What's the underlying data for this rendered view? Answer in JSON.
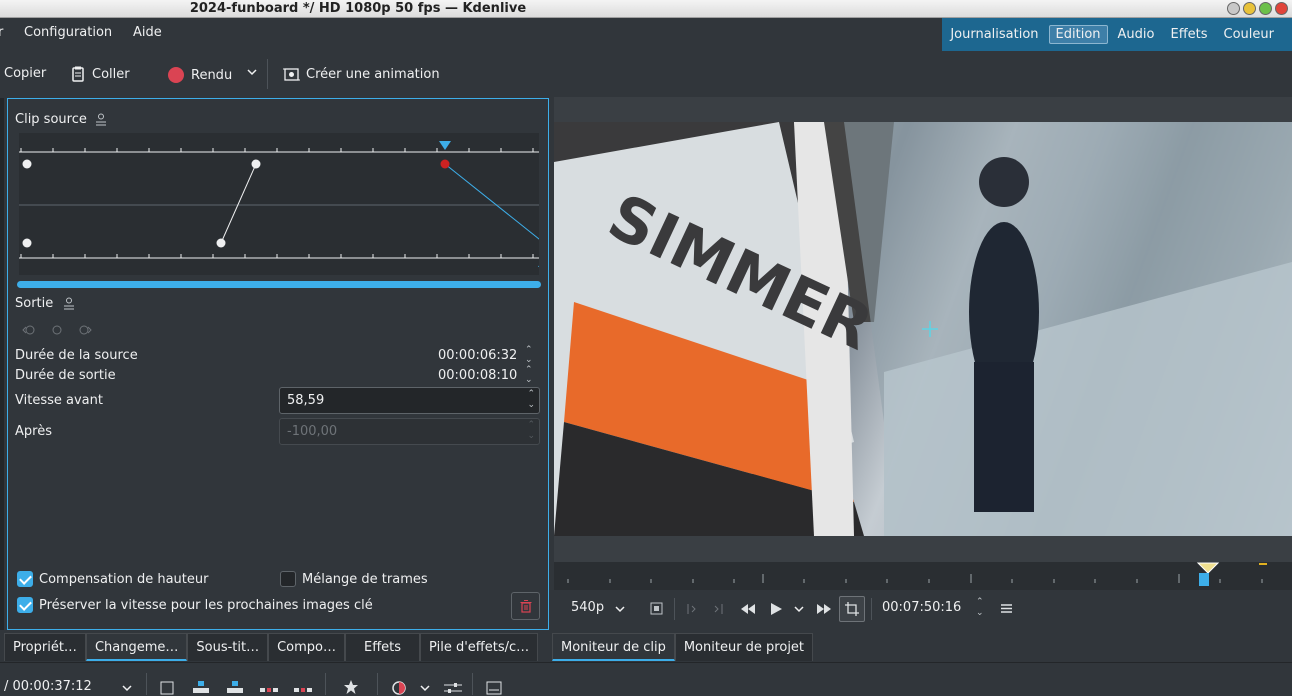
{
  "window": {
    "title": "2024-funboard */ HD 1080p 50 fps — Kdenlive"
  },
  "menu": {
    "items": [
      "Configuration",
      "Aide"
    ],
    "left_fragment": "r"
  },
  "layouts": {
    "items": [
      "Journalisation",
      "Edition",
      "Audio",
      "Effets",
      "Couleur"
    ],
    "active": "Edition"
  },
  "toolbar": {
    "copy": "Copier",
    "paste": "Coller",
    "render": "Rendu",
    "animation": "Créer une animation"
  },
  "panel": {
    "source_title": "Clip source",
    "output_title": "Sortie",
    "source_duration_label": "Durée de la source",
    "source_duration": "00:00:06:32",
    "output_duration_label": "Durée de sortie",
    "output_duration": "00:00:08:10",
    "speed_before_label": "Vitesse avant",
    "speed_before": "58,59",
    "after_label": "Après",
    "after_value": "-100,00",
    "pitch_comp": "Compensation de hauteur",
    "frame_blend": "Mélange de trames",
    "preserve_speed": "Préserver la vitesse pour les prochaines images clé",
    "pitch_comp_checked": true,
    "frame_blend_checked": false,
    "preserve_checked": true
  },
  "monitor": {
    "zoom": "540p",
    "timecode": "00:07:50:16",
    "image_text": "SIMMER"
  },
  "tabs_left": [
    "Propriét…",
    "Changeme…",
    "Sous-tit…",
    "Compo…",
    "Effets",
    "Pile d'effets/c…"
  ],
  "tabs_left_active": "Changeme…",
  "tabs_right": [
    "Moniteur de clip",
    "Moniteur de projet"
  ],
  "tabs_right_active": "Moniteur de clip",
  "bottom": {
    "timecode": "/ 00:00:37:12"
  },
  "colors": {
    "accent": "#3daee9",
    "record": "#da4453",
    "keyframe_red": "#cc2222"
  }
}
